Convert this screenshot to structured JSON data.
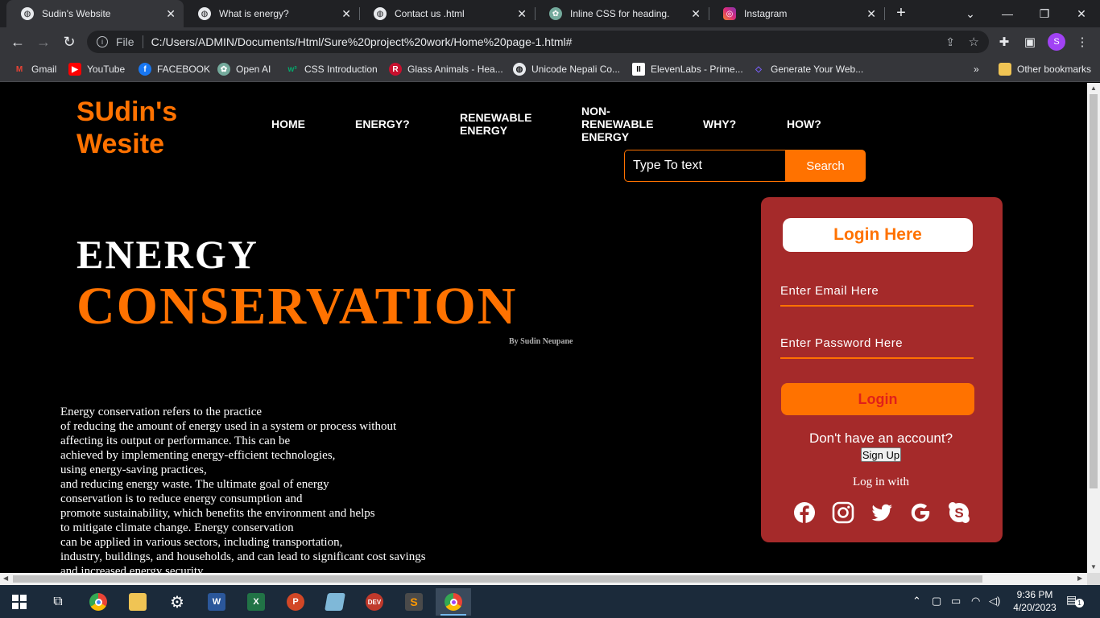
{
  "browser": {
    "tabs": [
      {
        "title": "Sudin's Website",
        "active": true
      },
      {
        "title": "What is energy?",
        "active": false
      },
      {
        "title": "Contact us .html",
        "active": false
      },
      {
        "title": "Inline CSS for heading.",
        "active": false
      },
      {
        "title": "Instagram",
        "active": false
      }
    ],
    "address": {
      "scheme_label": "File",
      "url": "C:/Users/ADMIN/Documents/Html/Sure%20project%20work/Home%20page-1.html#"
    },
    "profile_initial": "S",
    "bookmarks": [
      {
        "label": "Gmail",
        "icon": "gmail-icon",
        "color": "#ea4335"
      },
      {
        "label": "YouTube",
        "icon": "youtube-icon",
        "color": "#ff0000"
      },
      {
        "label": "FACEBOOK",
        "icon": "facebook-icon",
        "color": "#1877f2"
      },
      {
        "label": "Open AI",
        "icon": "openai-icon",
        "color": "#74aa9c"
      },
      {
        "label": "CSS Introduction",
        "icon": "w3schools-icon",
        "color": "#04aa6d"
      },
      {
        "label": "Glass Animals - Hea...",
        "icon": "glass-animals-icon",
        "color": "#c8102e"
      },
      {
        "label": "Unicode Nepali Co...",
        "icon": "globe-icon",
        "color": "#e8eaed"
      },
      {
        "label": "ElevenLabs - Prime...",
        "icon": "elevenlabs-icon",
        "color": "#ffffff"
      },
      {
        "label": "Generate Your Web...",
        "icon": "web-generator-icon",
        "color": "#7b61ff"
      }
    ],
    "other_bookmarks": "Other bookmarks"
  },
  "site": {
    "logo_line1": "SUdin's",
    "logo_line2": "Wesite",
    "nav": [
      {
        "label": "HOME"
      },
      {
        "label": "ENERGY?"
      },
      {
        "label_lines": [
          "RENEWABLE",
          "ENERGY"
        ]
      },
      {
        "label_lines": [
          "NON-",
          "RENEWABLE",
          "ENERGY"
        ]
      },
      {
        "label": "WHY?"
      },
      {
        "label": "HOW?"
      }
    ],
    "search": {
      "placeholder": "Type To text",
      "button": "Search"
    },
    "hero": {
      "line1": "ENERGY",
      "line2": "CONSERVATION",
      "byline": "By Sudin Neupane"
    },
    "paragraph_lines": [
      "Energy conservation refers to the practice",
      "of reducing the amount of energy used in a system or process without",
      "affecting its output or performance. This can be",
      "achieved by implementing energy-efficient technologies,",
      "using energy-saving practices,",
      "and reducing energy waste. The ultimate goal of energy",
      "conservation is to reduce energy consumption and",
      "promote sustainability, which benefits the environment and helps",
      "to mitigate climate change. Energy conservation",
      "can be applied in various sectors, including transportation,",
      "industry, buildings, and households, and can lead to significant cost savings",
      "and increased energy security."
    ],
    "login": {
      "title": "Login Here",
      "email_placeholder": "Enter Email Here",
      "password_placeholder": "Enter Password Here",
      "button": "Login",
      "no_account": "Don't have an account?",
      "signup": "Sign Up",
      "login_with": "Log in with",
      "social": [
        "facebook-icon",
        "instagram-icon",
        "twitter-icon",
        "google-icon",
        "skype-icon"
      ]
    },
    "colors": {
      "accent": "#ff7200",
      "card": "#a52a2a",
      "background": "#000000"
    }
  },
  "taskbar": {
    "time": "9:36 PM",
    "date": "4/20/2023",
    "notifications": "1"
  }
}
